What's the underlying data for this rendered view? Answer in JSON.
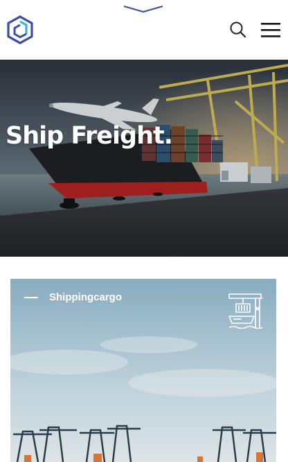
{
  "header": {
    "logo": "hexagon-logo-icon",
    "search_icon": "search-icon",
    "menu_icon": "hamburger-menu-icon",
    "accent_color": "#3b4da8"
  },
  "hero": {
    "title": "Ship Freight."
  },
  "service_card": {
    "label": "Shippingcargo",
    "icon": "port-crane-ship-icon"
  }
}
